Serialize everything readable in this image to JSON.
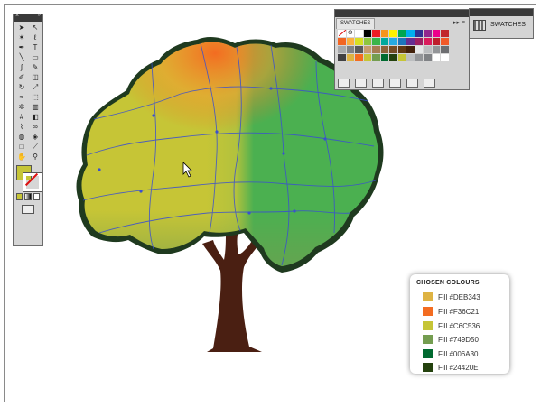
{
  "colors": {
    "trunk": "#4a1f12",
    "outline": "#1f3a1f",
    "path_lines": "#3a4fd0",
    "canopy_left": "#c6c536",
    "canopy_right": "#4bb050",
    "canopy_top": "#f36c21"
  },
  "tools_panel": {
    "icons": [
      "selection-tool-icon",
      "direct-selection-tool-icon",
      "magic-wand-tool-icon",
      "lasso-tool-icon",
      "pen-tool-icon",
      "type-tool-icon",
      "line-tool-icon",
      "rectangle-tool-icon",
      "paintbrush-tool-icon",
      "pencil-tool-icon",
      "blob-brush-tool-icon",
      "eraser-tool-icon",
      "rotate-tool-icon",
      "scale-tool-icon",
      "warp-tool-icon",
      "free-transform-tool-icon",
      "symbol-sprayer-tool-icon",
      "graph-tool-icon",
      "mesh-tool-icon",
      "gradient-tool-icon",
      "eyedropper-tool-icon",
      "blend-tool-icon",
      "live-paint-tool-icon",
      "live-paint-selection-icon",
      "artboard-tool-icon",
      "slice-tool-icon",
      "hand-tool-icon",
      "zoom-tool-icon"
    ],
    "fill_color": "#c6c536"
  },
  "swatches_panel": {
    "tab_label": "SWATCHES",
    "grid": [
      "none",
      "reg",
      "#ffffff",
      "#000000",
      "#ed1c24",
      "#f7941d",
      "#fff200",
      "#00a651",
      "#00aeef",
      "#2e3192",
      "#92278f",
      "#ec008c",
      "#c1272d",
      "#f26522",
      "#fbb040",
      "#d7df23",
      "#8dc63f",
      "#39b54a",
      "#00a99d",
      "#27aae1",
      "#1c75bc",
      "#662d91",
      "#9e1f63",
      "#da1c5c",
      "#be1e2d",
      "#f15a29",
      "#a7a9ac",
      "#808285",
      "#58595b",
      "#c69c6d",
      "#a67c52",
      "#8c6239",
      "#754c24",
      "#603913",
      "#42210b",
      "#e6e7e8",
      "#bcbec0",
      "#939598",
      "#6d6e71",
      "#414042",
      "#deb343",
      "#f36c21",
      "#c6c536",
      "#749d50",
      "#006a30",
      "#24420e",
      "#c6c536",
      "#bcbec0",
      "#939598",
      "#808285",
      "#ffffff",
      "#ffffff"
    ],
    "bottom_icons": [
      "swatch-library-icon",
      "show-kinds-icon",
      "swatch-options-icon",
      "new-color-group-icon",
      "new-swatch-icon",
      "delete-swatch-icon"
    ]
  },
  "swatches_collapsed": {
    "label": "SWATCHES"
  },
  "chosen_colours": {
    "title": "CHOSEN COLOURS",
    "items": [
      {
        "label": "Fill  #DEB343",
        "color": "#deb343"
      },
      {
        "label": "Fill  #F36C21",
        "color": "#f36c21"
      },
      {
        "label": "Fill  #C6C536",
        "color": "#c6c536"
      },
      {
        "label": "Fill  #749D50",
        "color": "#749d50"
      },
      {
        "label": "Fill  #006A30",
        "color": "#006a30"
      },
      {
        "label": "Fill  #24420E",
        "color": "#24420e"
      }
    ]
  }
}
